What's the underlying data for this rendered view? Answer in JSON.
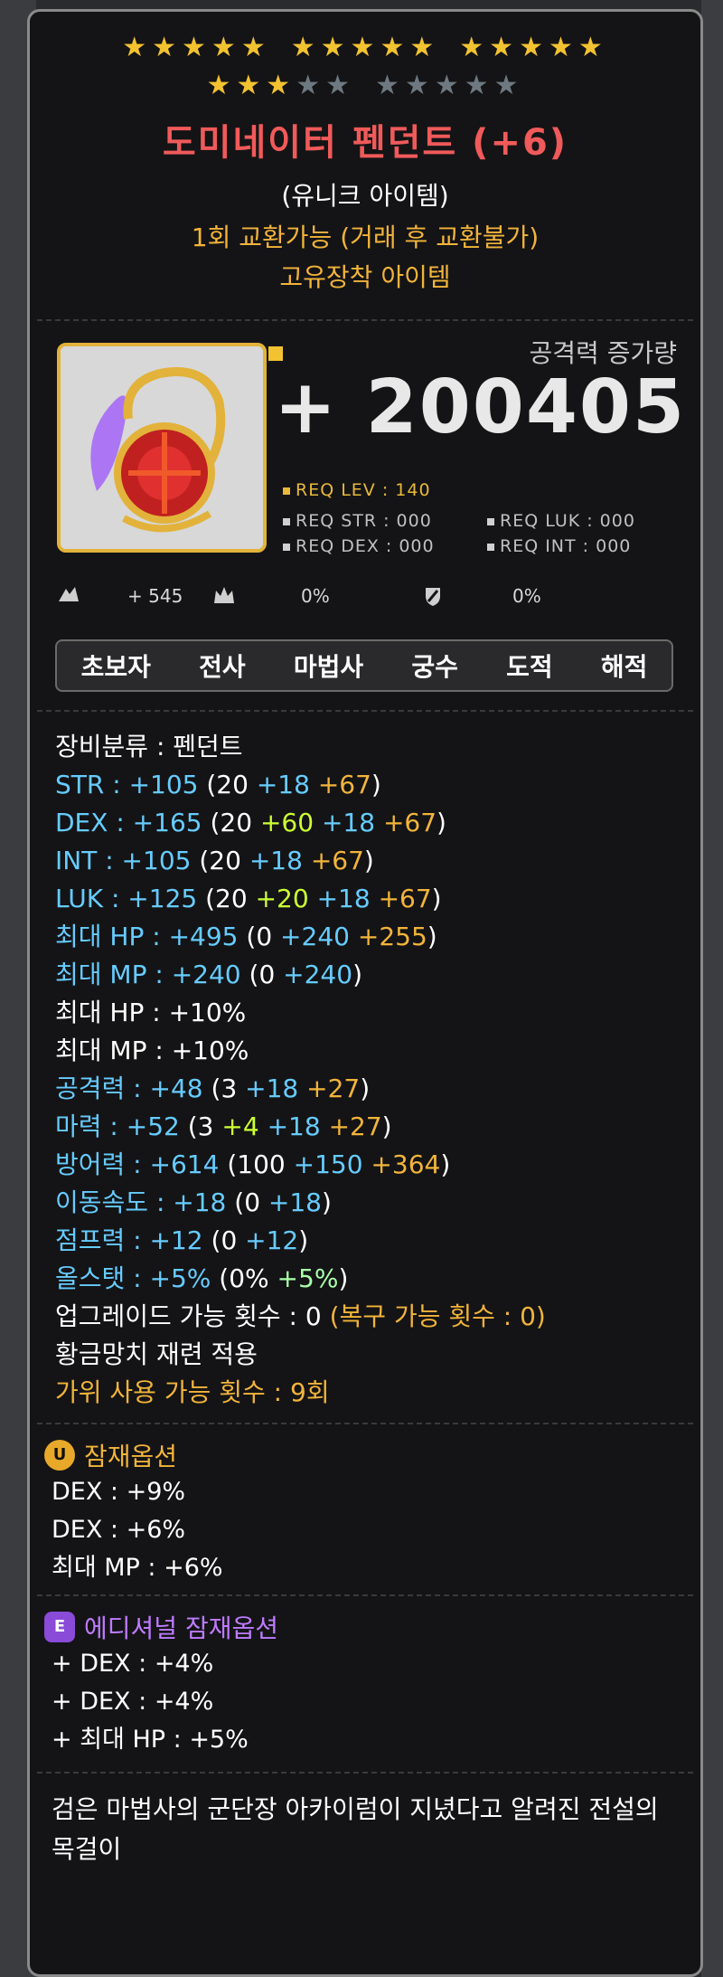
{
  "star_force": {
    "row1": [
      {
        "filled": 5,
        "empty": 0
      },
      {
        "filled": 5,
        "empty": 0
      },
      {
        "filled": 5,
        "empty": 0
      }
    ],
    "row2": [
      {
        "filled": 3,
        "empty": 2
      },
      {
        "filled": 0,
        "empty": 5
      }
    ],
    "filled_color": "#f2c230",
    "empty_color": "#6e7880"
  },
  "item": {
    "name": "도미네이터 펜던트 (+6)",
    "grade": "(유니크 아이템)",
    "trade": "1회 교환가능 (거래 후 교환불가)",
    "unique_equip": "고유장착 아이템",
    "attack_increase_label": "공격력 증가량",
    "attack_increase_value": "+ 200405",
    "req_lev": "REQ LEV : 140",
    "req_str": "REQ STR : 000",
    "req_luk": "REQ LUK : 000",
    "req_dex": "REQ DEX : 000",
    "req_int": "REQ INT : 000",
    "icon_stats": {
      "v1": "+ 545",
      "v2": "0%",
      "v3": "0%"
    },
    "jobs": [
      "초보자",
      "전사",
      "마법사",
      "궁수",
      "도적",
      "해적"
    ]
  },
  "stats": [
    {
      "label": "장비분류 : 펜던트",
      "label_color": "w",
      "parts": []
    },
    {
      "label": "STR : +105 ",
      "label_color": "b",
      "parts": [
        {
          "t": "(20 ",
          "c": "w"
        },
        {
          "t": "+18 ",
          "c": "b"
        },
        {
          "t": "+67",
          "c": "o"
        },
        {
          "t": ")",
          "c": "w"
        }
      ]
    },
    {
      "label": "DEX : +165 ",
      "label_color": "b",
      "parts": [
        {
          "t": "(20 ",
          "c": "w"
        },
        {
          "t": "+60 ",
          "c": "y"
        },
        {
          "t": "+18 ",
          "c": "b"
        },
        {
          "t": "+67",
          "c": "o"
        },
        {
          "t": ")",
          "c": "w"
        }
      ]
    },
    {
      "label": "INT : +105 ",
      "label_color": "b",
      "parts": [
        {
          "t": "(20 ",
          "c": "w"
        },
        {
          "t": "+18 ",
          "c": "b"
        },
        {
          "t": "+67",
          "c": "o"
        },
        {
          "t": ")",
          "c": "w"
        }
      ]
    },
    {
      "label": "LUK : +125 ",
      "label_color": "b",
      "parts": [
        {
          "t": "(20 ",
          "c": "w"
        },
        {
          "t": "+20 ",
          "c": "y"
        },
        {
          "t": "+18 ",
          "c": "b"
        },
        {
          "t": "+67",
          "c": "o"
        },
        {
          "t": ")",
          "c": "w"
        }
      ]
    },
    {
      "label": "최대 HP : +495 ",
      "label_color": "b",
      "parts": [
        {
          "t": "(0 ",
          "c": "w"
        },
        {
          "t": "+240 ",
          "c": "b"
        },
        {
          "t": "+255",
          "c": "o"
        },
        {
          "t": ")",
          "c": "w"
        }
      ]
    },
    {
      "label": "최대 MP : +240 ",
      "label_color": "b",
      "parts": [
        {
          "t": "(0 ",
          "c": "w"
        },
        {
          "t": "+240",
          "c": "b"
        },
        {
          "t": ")",
          "c": "w"
        }
      ]
    },
    {
      "label": "최대 HP : +10%",
      "label_color": "w",
      "parts": []
    },
    {
      "label": "최대 MP : +10%",
      "label_color": "w",
      "parts": []
    },
    {
      "label": "공격력 : +48 ",
      "label_color": "b",
      "parts": [
        {
          "t": "(3 ",
          "c": "w"
        },
        {
          "t": "+18 ",
          "c": "b"
        },
        {
          "t": "+27",
          "c": "o"
        },
        {
          "t": ")",
          "c": "w"
        }
      ]
    },
    {
      "label": "마력 : +52 ",
      "label_color": "b",
      "parts": [
        {
          "t": "(3 ",
          "c": "w"
        },
        {
          "t": "+4 ",
          "c": "y"
        },
        {
          "t": "+18 ",
          "c": "b"
        },
        {
          "t": "+27",
          "c": "o"
        },
        {
          "t": ")",
          "c": "w"
        }
      ]
    },
    {
      "label": "방어력 : +614 ",
      "label_color": "b",
      "parts": [
        {
          "t": "(100 ",
          "c": "w"
        },
        {
          "t": "+150 ",
          "c": "b"
        },
        {
          "t": "+364",
          "c": "o"
        },
        {
          "t": ")",
          "c": "w"
        }
      ]
    },
    {
      "label": "이동속도 : +18 ",
      "label_color": "b",
      "parts": [
        {
          "t": "(0 ",
          "c": "w"
        },
        {
          "t": "+18",
          "c": "b"
        },
        {
          "t": ")",
          "c": "w"
        }
      ]
    },
    {
      "label": "점프력 : +12 ",
      "label_color": "b",
      "parts": [
        {
          "t": "(0 ",
          "c": "w"
        },
        {
          "t": "+12",
          "c": "b"
        },
        {
          "t": ")",
          "c": "w"
        }
      ]
    },
    {
      "label": "올스탯 : +5% ",
      "label_color": "b",
      "parts": [
        {
          "t": "(0% ",
          "c": "w"
        },
        {
          "t": "+5%",
          "c": "lg"
        },
        {
          "t": ")",
          "c": "w"
        }
      ]
    },
    {
      "label": "업그레이드 가능 횟수 : 0 ",
      "label_color": "w",
      "parts": [
        {
          "t": "(복구 가능 횟수 : 0)",
          "c": "o"
        }
      ]
    },
    {
      "label": "황금망치 재련 적용",
      "label_color": "w",
      "parts": []
    },
    {
      "label": "가위 사용 가능 횟수 : 9회",
      "label_color": "o",
      "parts": []
    }
  ],
  "potential": {
    "badge": "U",
    "title": "잠재옵션",
    "lines": [
      "DEX : +9%",
      "DEX : +6%",
      "최대 MP : +6%"
    ]
  },
  "additional": {
    "badge": "E",
    "title": "에디셔널 잠재옵션",
    "lines": [
      "+ DEX : +4%",
      "+ DEX : +4%",
      "+ 최대 HP : +5%"
    ]
  },
  "description": "검은 마법사의 군단장 아카이럼이 지녔다고 알려진 전설의 목걸이"
}
